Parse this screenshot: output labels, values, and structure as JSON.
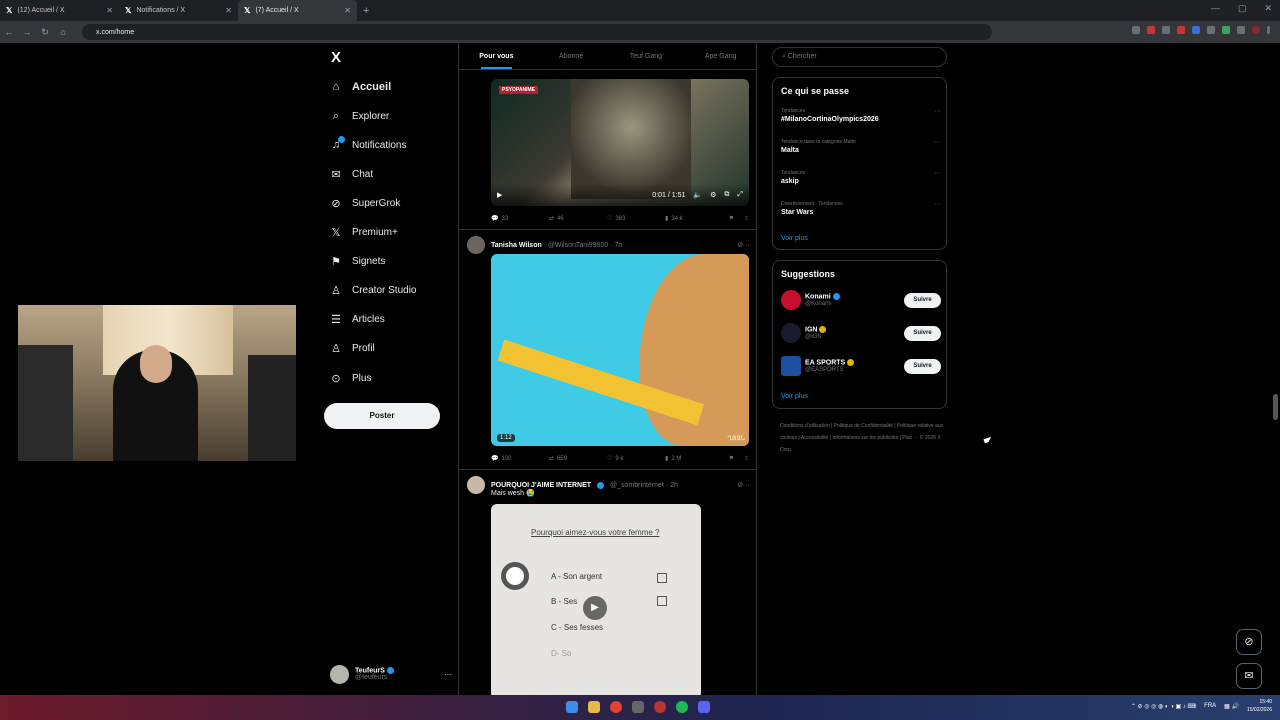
{
  "browser": {
    "tabs": [
      {
        "title": "(12) Accueil / X"
      },
      {
        "title": "Notifications / X"
      },
      {
        "title": "(7) Accueil / X"
      }
    ],
    "new_tab": "+",
    "url": "x.com/home"
  },
  "left_nav": {
    "logo": "X",
    "items": [
      {
        "label": "Accueil",
        "icon": "home-icon"
      },
      {
        "label": "Explorer",
        "icon": "search-icon"
      },
      {
        "label": "Notifications",
        "icon": "bell-icon"
      },
      {
        "label": "Chat",
        "icon": "mail-icon"
      },
      {
        "label": "SuperGrok",
        "icon": "grok-icon"
      },
      {
        "label": "Premium+",
        "icon": "x-icon"
      },
      {
        "label": "Signets",
        "icon": "bookmark-icon"
      },
      {
        "label": "Creator Studio",
        "icon": "creator-icon"
      },
      {
        "label": "Articles",
        "icon": "article-icon"
      },
      {
        "label": "Profil",
        "icon": "person-icon"
      },
      {
        "label": "Plus",
        "icon": "more-circle-icon"
      }
    ],
    "post_button": "Poster",
    "profile": {
      "name": "TeufeurS",
      "handle": "@teufeurs"
    }
  },
  "timeline": {
    "tabs": [
      "Pour vous",
      "Abonné",
      "Teuf Gang",
      "Ape Gang"
    ],
    "tweets": [
      {
        "video": {
          "time": "0:01 / 1:51",
          "badge": "PSYOPANIME"
        },
        "stats": {
          "replies": "33",
          "reposts": "46",
          "likes": "383",
          "views": "34 k"
        }
      },
      {
        "name": "Tanisha Wilson",
        "handle": "@WilsonTani99800 · 7h",
        "video": {
          "duration": "1:12",
          "watermark": "ՂՅՅՆ"
        },
        "stats": {
          "replies": "100",
          "reposts": "659",
          "likes": "9 k",
          "views": "2 M"
        }
      },
      {
        "name": "POURQUOI J'AIME INTERNET",
        "handle": "@_sombrinternet · 2h",
        "text": "Mais wesh 😭",
        "video": {
          "question": "Pourquoi aimez-vous votre femme ?",
          "options": [
            "A - Son argent",
            "B - Ses",
            "C - Ses fesses",
            "D- So"
          ]
        }
      }
    ]
  },
  "right_col": {
    "search_placeholder": "Chercher",
    "trends_title": "Ce qui se passe",
    "trends": [
      {
        "category": "Tendances",
        "name": "#MilanoCortinaOlympics2026"
      },
      {
        "category": "Tendance dans la catégorie Malte",
        "name": "Malta"
      },
      {
        "category": "Tendances",
        "name": "askip"
      },
      {
        "category": "Divertissement · Tendances",
        "name": "Star Wars"
      }
    ],
    "trends_more": "Voir plus",
    "suggestions_title": "Suggestions",
    "suggestions": [
      {
        "name": "Konami",
        "handle": "@Konami",
        "button": "Suivre",
        "color": "#c8102e"
      },
      {
        "name": "IGN",
        "handle": "@IGN",
        "button": "Suivre",
        "color": "#1a1a2e"
      },
      {
        "name": "EA SPORTS",
        "handle": "@EASPORTS",
        "button": "Suivre",
        "color": "#1c4fa0"
      }
    ],
    "suggestions_more": "Voir plus",
    "footer": "Conditions d'utilisation | Politique de Confidentialité | Politique relative aux cookies | Accessibilité | Informations sur les publicités | Plus ··· © 2026 X Corp."
  },
  "taskbar": {
    "lang": "FRA",
    "time": "15:40",
    "date": "15/02/2026"
  }
}
